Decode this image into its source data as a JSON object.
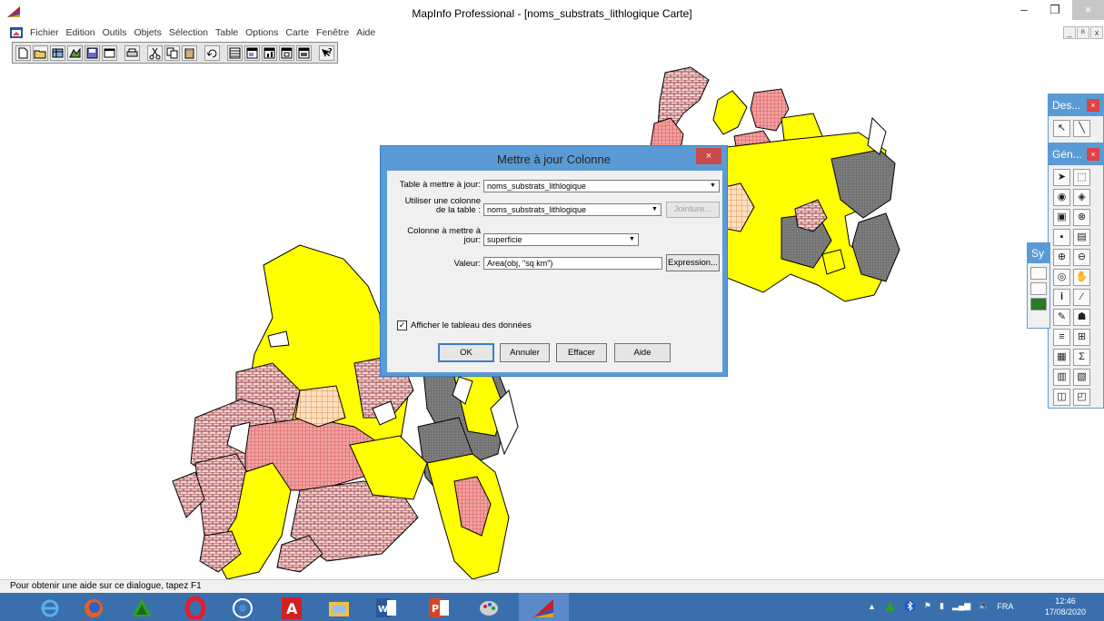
{
  "window": {
    "title": "MapInfo Professional - [noms_substrats_lithlogique Carte]",
    "controls": {
      "minimize": "–",
      "maximize": "❐",
      "close": "×"
    },
    "mdi_controls": [
      "_",
      "ᴮ",
      "x"
    ]
  },
  "menu": {
    "items": [
      "Fichier",
      "Edition",
      "Outils",
      "Objets",
      "Sélection",
      "Table",
      "Options",
      "Carte",
      "Fenêtre",
      "Aide"
    ]
  },
  "toolbar": {
    "buttons": [
      "new-icon",
      "open-icon",
      "open-table-icon",
      "open-workspace-icon",
      "save-icon",
      "window-icon",
      "print-icon",
      "cut-icon",
      "copy-icon",
      "paste-icon",
      "undo-icon",
      "browser-icon",
      "map-icon",
      "graph-icon",
      "layout-icon",
      "table-icon",
      "help-icon"
    ]
  },
  "palettes": {
    "draw": {
      "title": "Des...",
      "close": "×"
    },
    "general": {
      "title": "Gén...",
      "close": "×"
    },
    "symbol": {
      "title": "Sy"
    }
  },
  "dialog": {
    "title": "Mettre à jour Colonne",
    "close": "×",
    "table_label": "Table à mettre à jour:",
    "table_value": "noms_substrats_lithlogique",
    "use_column_label_1": "Utiliser une colonne",
    "use_column_label_2": "de la table :",
    "use_column_value": "noms_substrats_lithlogique",
    "join_button": "Jointure...",
    "column_label_1": "Colonne à mettre à",
    "column_label_2": "jour:",
    "column_value": "superficie",
    "value_label": "Valeur:",
    "value_value": "Area(obj, \"sq km\")",
    "expression_button": "Expression...",
    "show_data_label": "Afficher le tableau des données",
    "show_data_checked": true,
    "ok_button": "OK",
    "cancel_button": "Annuler",
    "clear_button": "Effacer",
    "help_button": "Aide",
    "dropdown_glyph": "▼",
    "check_glyph": "✓"
  },
  "status": {
    "text": "Pour obtenir une aide sur ce dialogue, tapez F1"
  },
  "taskbar": {
    "language": "FRA",
    "time": "12:46",
    "date": "17/08/2020"
  },
  "colors": {
    "accent": "#5b9bd5",
    "yellow_unit": "#ffff00",
    "grey_unit": "#808080",
    "pink_unit": "#f0a0a0",
    "brick_unit": "#c0504d",
    "taskbar": "#3a6fae"
  }
}
